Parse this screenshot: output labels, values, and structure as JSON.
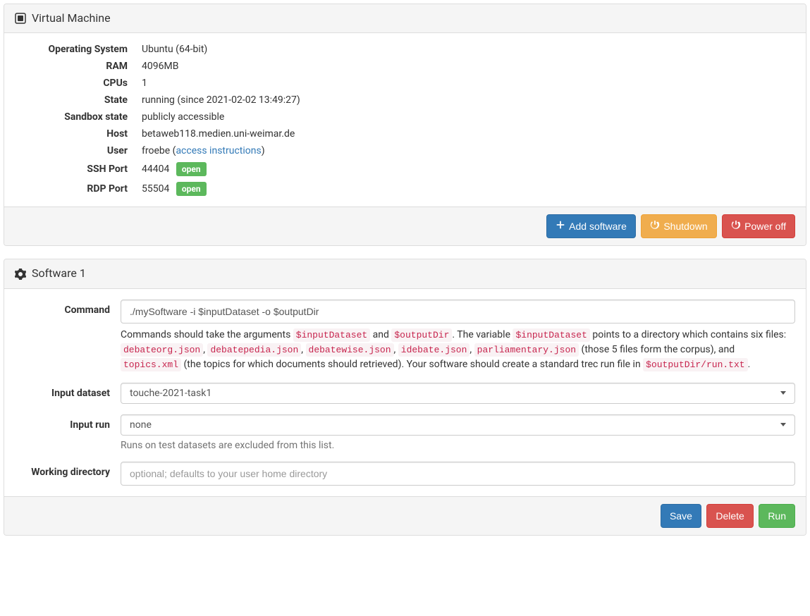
{
  "vm_panel": {
    "title": "Virtual Machine",
    "rows": {
      "os_label": "Operating System",
      "os_value": "Ubuntu (64-bit)",
      "ram_label": "RAM",
      "ram_value": "4096MB",
      "cpu_label": "CPUs",
      "cpu_value": "1",
      "state_label": "State",
      "state_value": "running (since 2021-02-02 13:49:27)",
      "sandbox_label": "Sandbox state",
      "sandbox_value": "publicly accessible",
      "host_label": "Host",
      "host_value": "betaweb118.medien.uni-weimar.de",
      "user_label": "User",
      "user_value_prefix": "froebe (",
      "user_link": "access instructions",
      "user_value_suffix": ")",
      "ssh_label": "SSH Port",
      "ssh_value": "44404",
      "ssh_badge": "open",
      "rdp_label": "RDP Port",
      "rdp_value": "55504",
      "rdp_badge": "open"
    },
    "buttons": {
      "add_software": "Add software",
      "shutdown": "Shutdown",
      "poweroff": "Power off"
    }
  },
  "software_panel": {
    "title": "Software 1",
    "command_label": "Command",
    "command_value": "./mySoftware -i $inputDataset -o $outputDir",
    "help": {
      "pre1": "Commands should take the arguments ",
      "code1": "$inputDataset",
      "mid1": " and ",
      "code2": "$outputDir",
      "mid2": ". The variable ",
      "code3": "$inputDataset",
      "mid3": " points to a directory which contains six files: ",
      "code4": "debateorg.json",
      "sep1": ", ",
      "code5": "debatepedia.json",
      "sep2": ", ",
      "code6": "debatewise.json",
      "sep3": ", ",
      "code7": "idebate.json",
      "sep4": ", ",
      "code8": "parliamentary.json",
      "mid4": " (those 5 files form the corpus), and ",
      "code9": "topics.xml",
      "mid5": " (the topics for which documents should retrieved). Your software should create a standard trec run file in ",
      "code10": "$outputDir/run.txt",
      "end": "."
    },
    "input_dataset_label": "Input dataset",
    "input_dataset_value": "touche-2021-task1",
    "input_run_label": "Input run",
    "input_run_value": "none",
    "input_run_help": "Runs on test datasets are excluded from this list.",
    "wd_label": "Working directory",
    "wd_placeholder": "optional; defaults to your user home directory",
    "buttons": {
      "save": "Save",
      "delete": "Delete",
      "run": "Run"
    }
  }
}
